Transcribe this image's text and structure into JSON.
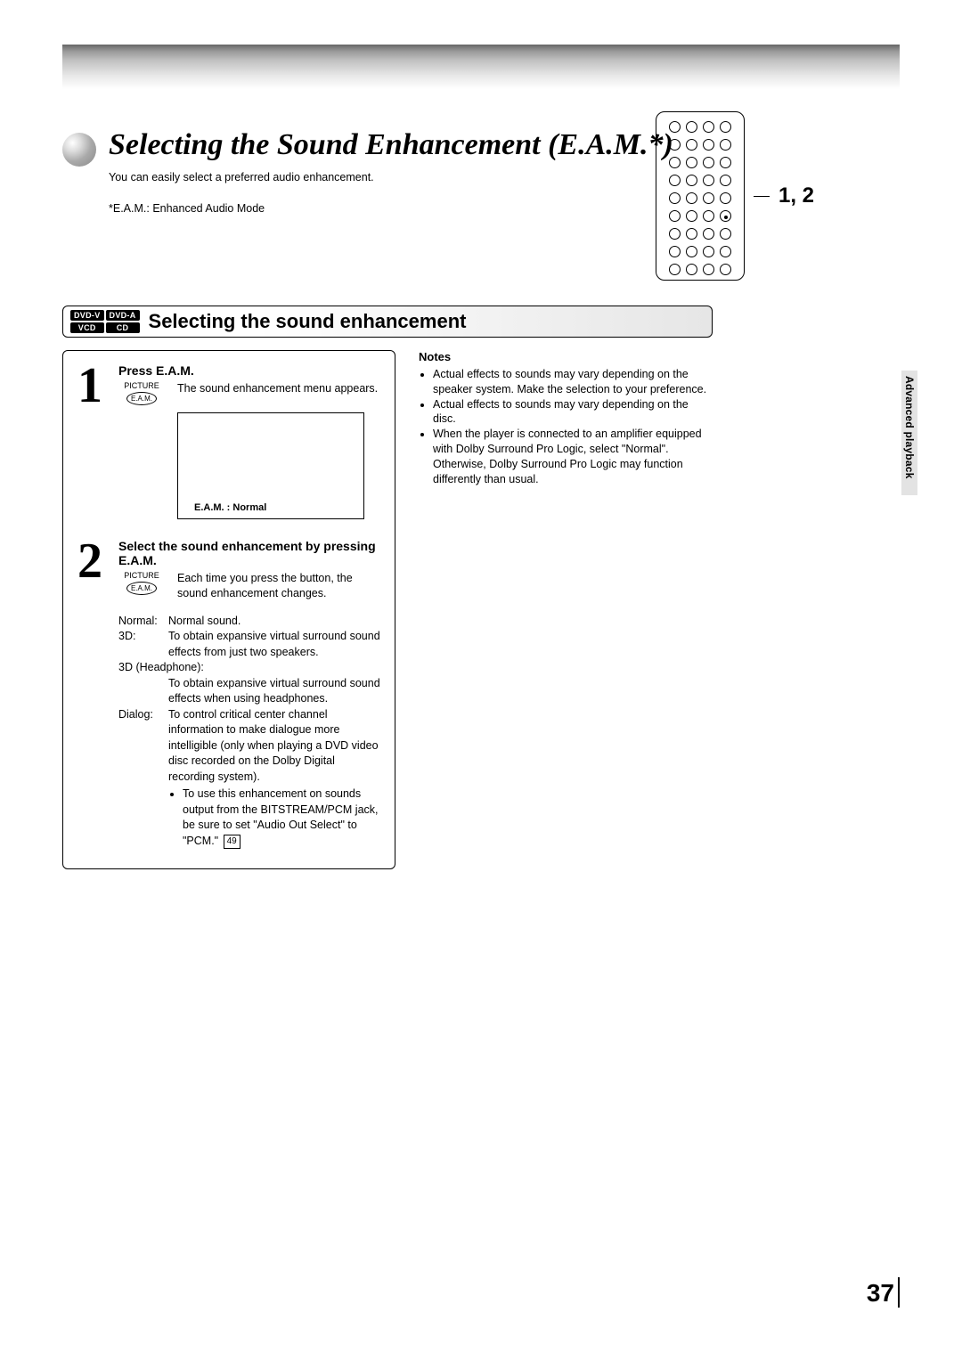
{
  "title": "Selecting the Sound Enhancement (E.A.M.*)",
  "intro_line": "You can easily select a preferred audio enhancement.",
  "intro_def": "*E.A.M.: Enhanced Audio Mode",
  "remote": {
    "indicator": "1, 2"
  },
  "section": {
    "badges": [
      "DVD-V",
      "DVD-A",
      "VCD",
      "CD"
    ],
    "title": "Selecting the sound enhancement"
  },
  "step1": {
    "num": "1",
    "title": "Press E.A.M.",
    "key_label": "PICTURE",
    "key_cap": "E.A.M.",
    "desc": "The sound enhancement menu appears.",
    "menu_caption": "E.A.M. : Normal"
  },
  "step2": {
    "num": "2",
    "title": "Select the sound enhancement by pressing E.A.M.",
    "key_label": "PICTURE",
    "key_cap": "E.A.M.",
    "desc": "Each time you press the button, the sound enhancement changes."
  },
  "modes": {
    "normal": {
      "key": "Normal:",
      "val": "Normal sound."
    },
    "threeD": {
      "key": "3D:",
      "val": "To obtain expansive virtual surround sound effects from just two speakers."
    },
    "headphone": {
      "key": "3D (Headphone):",
      "val": "To obtain expansive virtual surround sound effects when using headphones."
    },
    "dialog": {
      "key": "Dialog:",
      "val": "To control critical center channel information to make dialogue more intelligible (only when playing a DVD video disc recorded on the Dolby Digital recording system)."
    },
    "dialog_sub_pre": "To use this enhancement on sounds output from the BITSTREAM/PCM jack, be sure to set \"Audio Out Select\" to \"PCM.\"",
    "pageref": "49"
  },
  "notes": {
    "title": "Notes",
    "items": [
      "Actual effects to sounds may vary depending on the speaker system.  Make the selection to your preference.",
      "Actual effects to sounds may vary depending on the disc.",
      "When the player is connected to an amplifier equipped with Dolby Surround Pro Logic, select \"Normal\". Otherwise, Dolby Surround Pro Logic may function differently than usual."
    ]
  },
  "side_tab": "Advanced playback",
  "page_number": "37"
}
